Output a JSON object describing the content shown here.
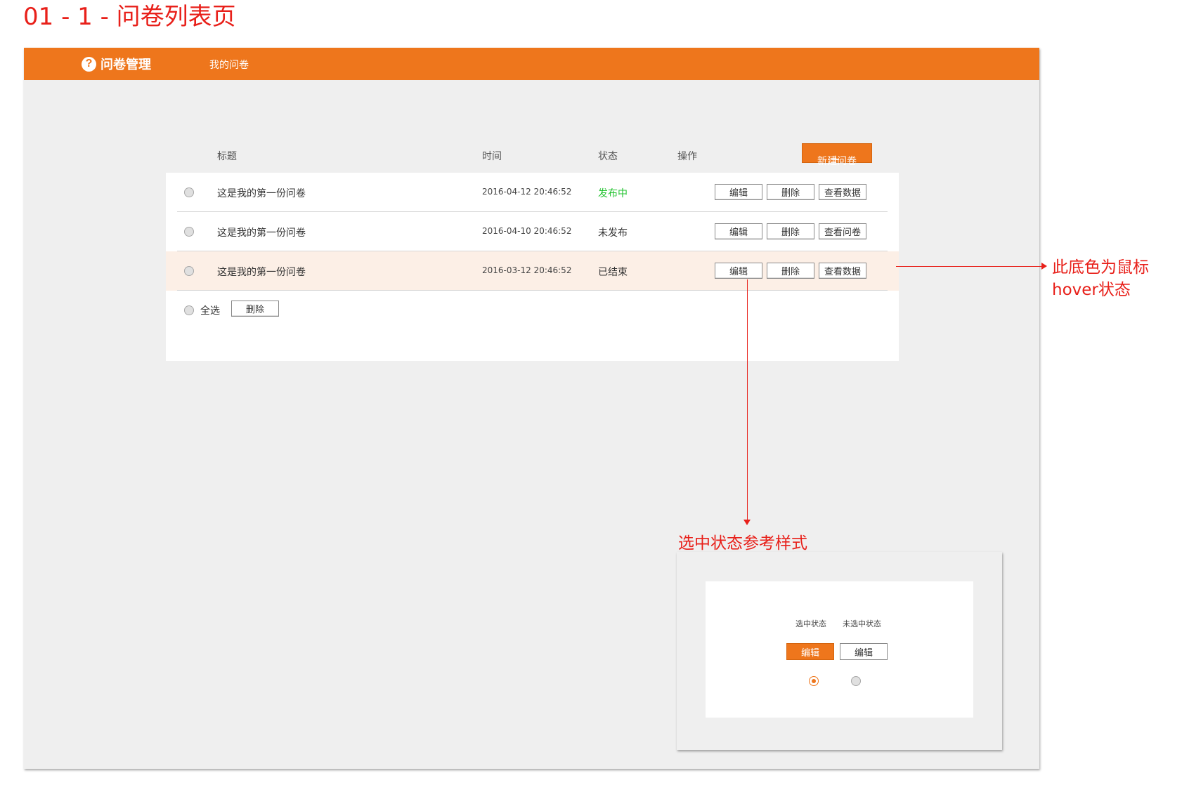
{
  "page_title": "01 - 1 - 问卷列表页",
  "app": {
    "logo_icon": "?",
    "logo_text": "问卷管理",
    "nav_item": "我的问卷"
  },
  "table": {
    "headers": {
      "title": "标题",
      "time": "时间",
      "status": "状态",
      "action": "操作"
    },
    "new_button": "新建问卷",
    "rows": [
      {
        "title": "这是我的第一份问卷",
        "time": "2016-04-12 20:46:52",
        "status": "发布中",
        "actions": [
          "编辑",
          "删除",
          "查看数据"
        ]
      },
      {
        "title": "这是我的第一份问卷",
        "time": "2016-04-10 20:46:52",
        "status": "未发布",
        "actions": [
          "编辑",
          "删除",
          "查看问卷"
        ]
      },
      {
        "title": "这是我的第一份问卷",
        "time": "2016-03-12 20:46:52",
        "status": "已结束",
        "actions": [
          "编辑",
          "删除",
          "查看数据"
        ]
      }
    ],
    "select_all": "全选",
    "bulk_delete": "删除"
  },
  "annotations": {
    "hover_note_line1": "此底色为鼠标",
    "hover_note_line2": "hover状态",
    "selected_style_note": "选中状态参考样式"
  },
  "reference": {
    "selected_label": "选中状态",
    "unselected_label": "未选中状态",
    "button_label": "编辑"
  },
  "colors": {
    "brand": "#ee761c",
    "publishing_status": "#22c32f",
    "hover_row": "#fcefe6",
    "annotation": "#e8201a"
  }
}
